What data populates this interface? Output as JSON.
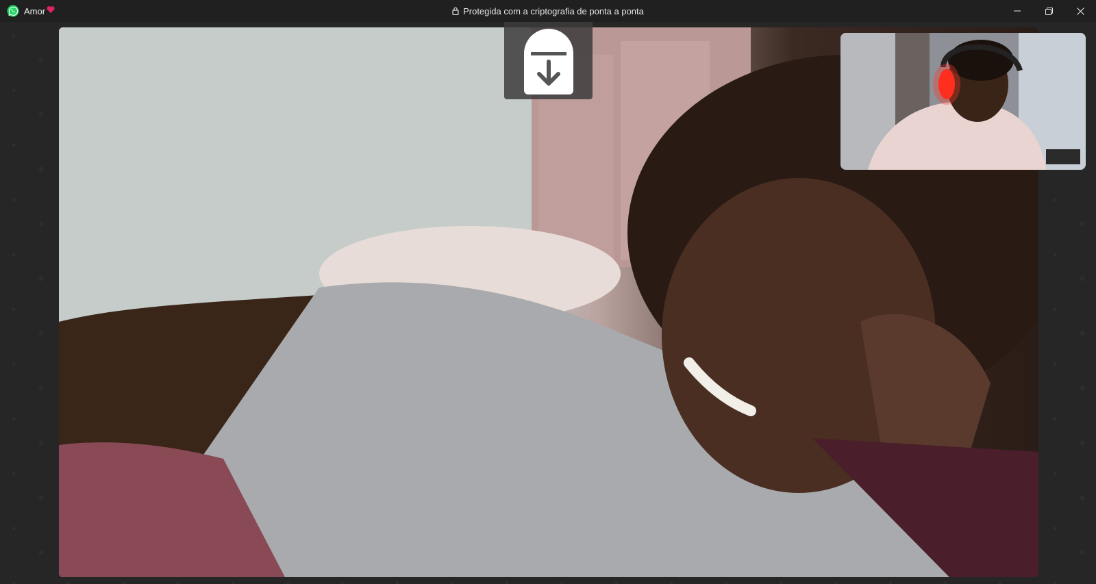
{
  "titlebar": {
    "chat_name": "Amor",
    "status": "Protegida com a criptografia de ponta a ponta"
  },
  "icons": {
    "app": "whatsapp-icon",
    "heart": "heart-emoji",
    "lock": "lock-icon",
    "minimize": "minimize-icon",
    "maximize": "restore-icon",
    "close": "close-icon",
    "download": "download-lock-icon"
  },
  "colors": {
    "titlebar_bg": "#202020",
    "whatsapp_green": "#25D366",
    "heart_red": "#e0245e"
  }
}
